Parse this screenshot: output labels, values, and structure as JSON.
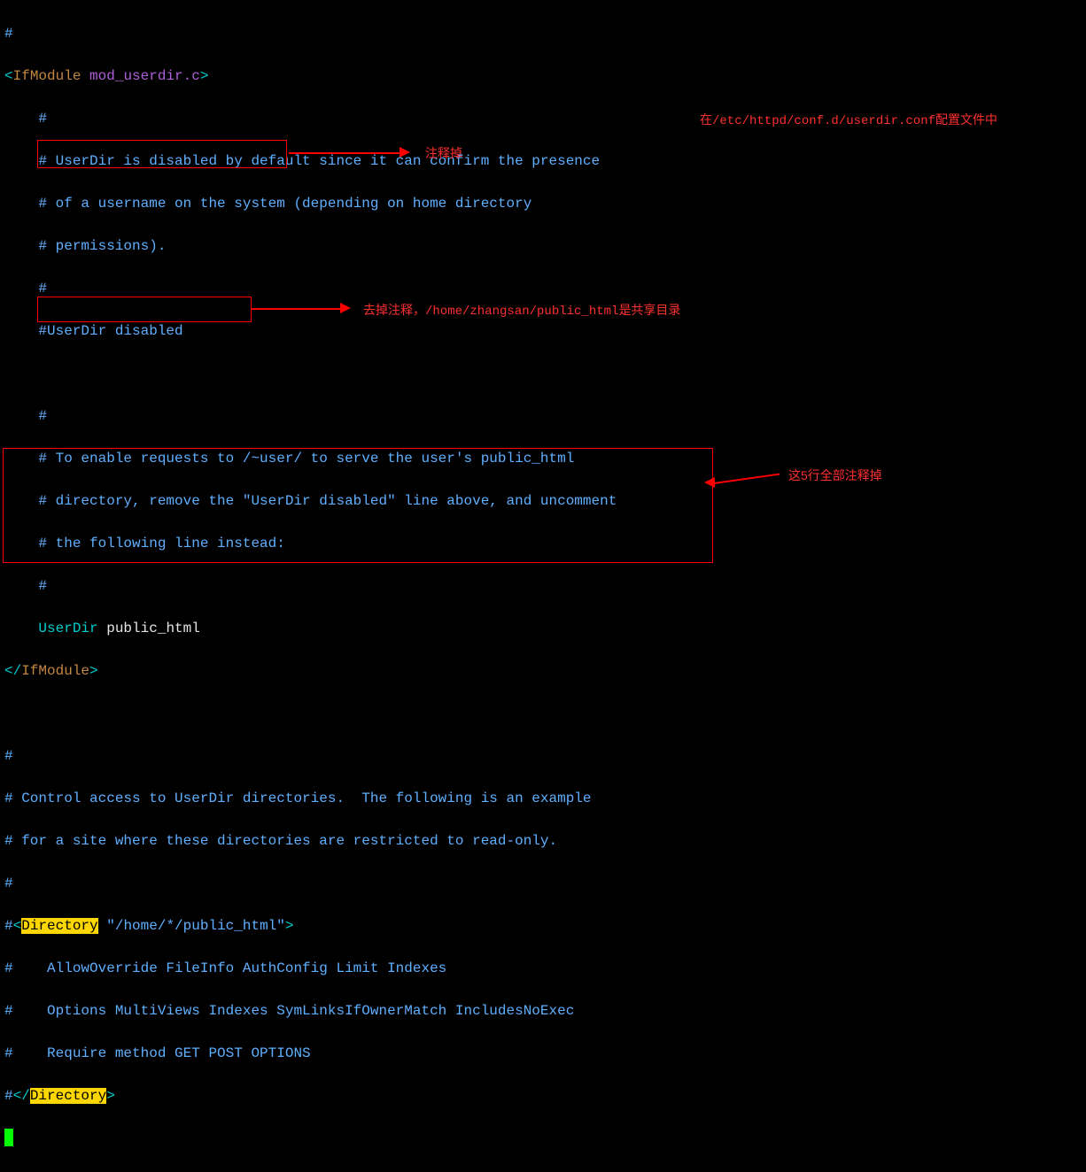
{
  "header": {
    "hash": "#"
  },
  "ifmodule": {
    "open_bracket": "<",
    "tag": "IfModule",
    "arg": "mod_userdir.c",
    "close_bracket": ">",
    "close_open": "</",
    "close_tag": "IfModule",
    "close_end": ">"
  },
  "block1": {
    "l1": "    #",
    "l2": "    # UserDir is disabled by default since it can confirm the presence",
    "l3": "    # of a username on the system (depending on home directory",
    "l4": "    # permissions).",
    "l5": "    #",
    "l6": "    #UserDir disabled"
  },
  "block2": {
    "l1": "    #",
    "l2": "    # To enable requests to /~user/ to serve the user's public_html",
    "l3": "    # directory, remove the \"UserDir disabled\" line above, and uncomment",
    "l4": "    # the following line instead:",
    "l5": "    #",
    "indent": "    ",
    "userdir": "UserDir",
    "pubhtml": " public_html"
  },
  "block3": {
    "l1": "#",
    "l2": "# Control access to UserDir directories.  The following is an example",
    "l3": "# for a site where these directories are restricted to read-only.",
    "l4": "#"
  },
  "dirblock": {
    "hash": "#",
    "lt": "<",
    "dir": "Directory",
    "path": " \"/home/*/public_html\"",
    "gt": ">",
    "l2": "#    AllowOverride FileInfo AuthConfig Limit Indexes",
    "l3": "#    Options MultiViews Indexes SymLinksIfOwnerMatch IncludesNoExec",
    "l4": "#    Require method GET POST OPTIONS",
    "close_lt": "</",
    "close_gt": ">"
  },
  "annotations": {
    "a1": "注释掉",
    "a2_prefix": "去掉注释，",
    "a2_path": "/home/zhangsan/public_html",
    "a2_suffix": "是共享目录",
    "a3_prefix": "在",
    "a3_path": "/etc/httpd/conf.d/userdir.conf",
    "a3_suffix": "配置文件中",
    "a4": "这5行全部注释掉"
  }
}
